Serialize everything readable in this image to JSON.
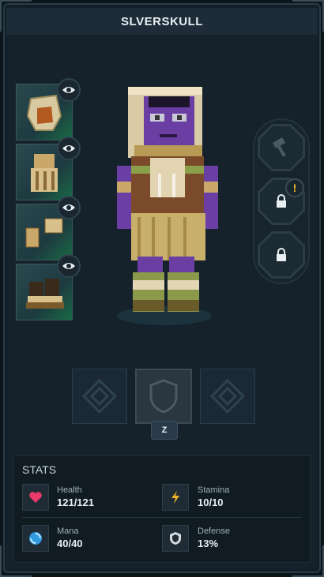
{
  "title": "SLVERSKULL",
  "armor_slots": [
    {
      "name": "hood",
      "visible_icon": "eye-icon"
    },
    {
      "name": "chest",
      "visible_icon": "eye-icon"
    },
    {
      "name": "gloves",
      "visible_icon": "eye-icon"
    },
    {
      "name": "boots",
      "visible_icon": "eye-icon"
    }
  ],
  "right_slots": {
    "tool_icon": "hammer-icon",
    "lock_icon": "lock-icon",
    "alert_text": "!"
  },
  "hotkey": "Z",
  "stats": {
    "heading": "STATS",
    "health": {
      "label": "Health",
      "value": "121/121",
      "color": "#e83a6a"
    },
    "stamina": {
      "label": "Stamina",
      "value": "10/10",
      "color": "#f0b429"
    },
    "mana": {
      "label": "Mana",
      "value": "40/40",
      "color": "#2f9ae0"
    },
    "defense": {
      "label": "Defense",
      "value": "13%",
      "color": "#d8dde2"
    }
  }
}
